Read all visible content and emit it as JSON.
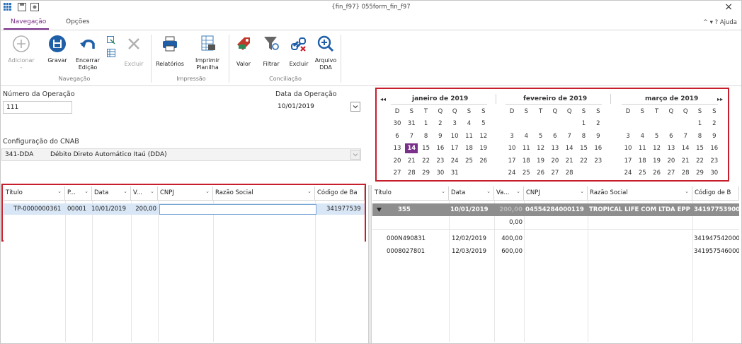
{
  "window": {
    "title": "{fin_f97} 055form_fin_f97",
    "close": "×"
  },
  "tabs": [
    {
      "label": "Navegação"
    },
    {
      "label": "Opções"
    }
  ],
  "help": {
    "label": "Ajuda",
    "icons": "^  ▾  ?"
  },
  "ribbon": {
    "adicionar": "Adicionar",
    "adicionar_sub": "-",
    "gravar": "Gravar",
    "encerrar": "Encerrar",
    "encerrar2": "Edição",
    "excluir": "Excluir",
    "relatorios": "Relatórios",
    "imprimir": "Imprimir",
    "planilha": "Planilha",
    "valor": "Valor",
    "filtrar": "Filtrar",
    "excluir2": "Excluir",
    "arquivo": "Arquivo",
    "dda": "DDA",
    "groups": {
      "navegacao": "Navegação",
      "impressao": "Impressão",
      "conciliacao": "Conciliação"
    }
  },
  "form": {
    "numero_label": "Número da Operação",
    "numero_value": "111",
    "data_label": "Data da Operação",
    "data_value": "10/01/2019",
    "config_label": "Configuração do CNAB",
    "config_code": "341-DDA",
    "config_desc": "Débito Direto Automático Itaú (DDA)"
  },
  "calendar": {
    "prev": "◂◂",
    "next": "▸▸",
    "weekdays": [
      "D",
      "S",
      "T",
      "Q",
      "Q",
      "S",
      "S"
    ],
    "months": [
      {
        "name": "janeiro de 2019",
        "days": [
          [
            "30",
            "31",
            "1",
            "2",
            "3",
            "4",
            "5"
          ],
          [
            "6",
            "7",
            "8",
            "9",
            "10",
            "11",
            "12"
          ],
          [
            "13",
            "14",
            "15",
            "16",
            "17",
            "18",
            "19"
          ],
          [
            "20",
            "21",
            "22",
            "23",
            "24",
            "25",
            "26"
          ],
          [
            "27",
            "28",
            "29",
            "30",
            "31",
            "",
            ""
          ]
        ],
        "selected": "14"
      },
      {
        "name": "fevereiro de 2019",
        "days": [
          [
            "",
            "",
            "",
            "",
            "",
            "1",
            "2"
          ],
          [
            "3",
            "4",
            "5",
            "6",
            "7",
            "8",
            "9"
          ],
          [
            "10",
            "11",
            "12",
            "13",
            "14",
            "15",
            "16"
          ],
          [
            "17",
            "18",
            "19",
            "20",
            "21",
            "22",
            "23"
          ],
          [
            "24",
            "25",
            "26",
            "27",
            "28",
            "",
            ""
          ]
        ]
      },
      {
        "name": "março de 2019",
        "days": [
          [
            "",
            "",
            "",
            "",
            "",
            "1",
            "2"
          ],
          [
            "3",
            "4",
            "5",
            "6",
            "7",
            "8",
            "9"
          ],
          [
            "10",
            "11",
            "12",
            "13",
            "14",
            "15",
            "16"
          ],
          [
            "17",
            "18",
            "19",
            "20",
            "21",
            "22",
            "23"
          ],
          [
            "24",
            "25",
            "26",
            "27",
            "28",
            "29",
            "30"
          ]
        ]
      }
    ]
  },
  "left_grid": {
    "columns": [
      "Título",
      "P...",
      "Data",
      "V...",
      "CNPJ",
      "Razão Social",
      "Código de Ba"
    ],
    "row": [
      "TP-0000000361",
      "00001",
      "10/01/2019",
      "200,00",
      "",
      "",
      "341977539"
    ]
  },
  "right_grid": {
    "columns": [
      "Título",
      "Data",
      "Va...",
      "CNPJ",
      "Razão Social",
      "Código de B"
    ],
    "group": {
      "titulo": "355",
      "data": "10/01/2019",
      "valor": "200,00",
      "cnpj": "04554284000119",
      "razao": "TROPICAL LIFE COM LTDA EPP",
      "codigo": "34197753900"
    },
    "subtotal": "0,00",
    "rows": [
      [
        "000N490831",
        "12/02/2019",
        "400,00",
        "",
        "",
        "341947542000"
      ],
      [
        "0008027801",
        "12/03/2019",
        "600,00",
        "",
        "",
        "341957546000"
      ]
    ]
  },
  "colors": {
    "accent": "#7a2f8a",
    "highlight": "#c81e2c",
    "selection": "#d8e6f6",
    "group_row": "#8e8e8e"
  }
}
